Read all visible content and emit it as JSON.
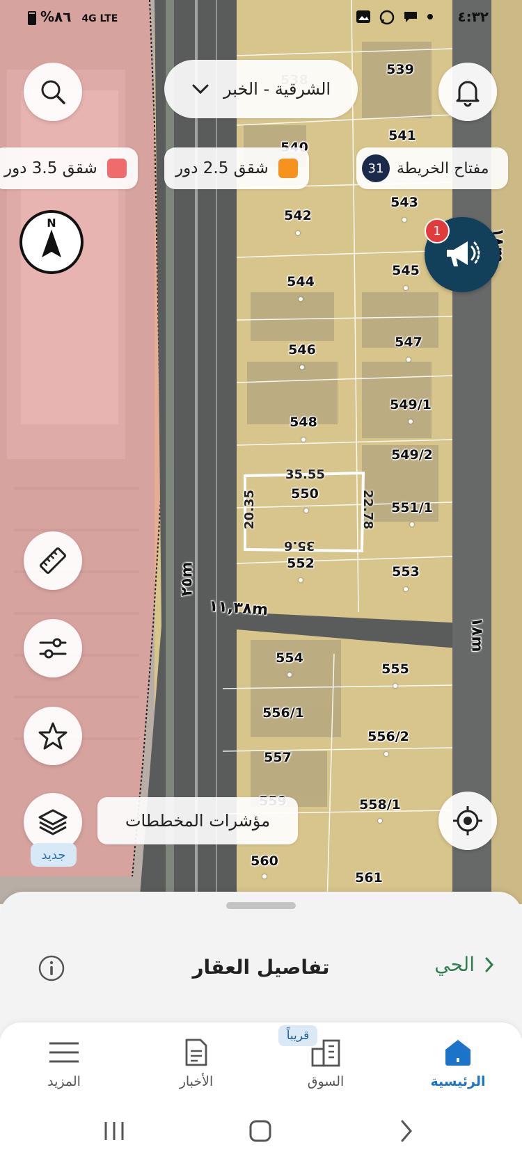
{
  "status_bar": {
    "time": "٤:٣٢",
    "battery": "%٨٦",
    "network": "4G LTE"
  },
  "map": {
    "region_selector": {
      "label": "الشرقية - الخبر"
    },
    "legend": [
      {
        "label": "شقق 3.5 دور",
        "color": "#f06b6b"
      },
      {
        "label": "شقق 2.5 دور",
        "color": "#f6931e"
      }
    ],
    "map_key": {
      "label": "مفتاح الخريطة",
      "count": "31"
    },
    "announcement": {
      "badge": "1"
    },
    "plots": [
      {
        "id": "538"
      },
      {
        "id": "539"
      },
      {
        "id": "540"
      },
      {
        "id": "541"
      },
      {
        "id": "542"
      },
      {
        "id": "543"
      },
      {
        "id": "544"
      },
      {
        "id": "545"
      },
      {
        "id": "546"
      },
      {
        "id": "547"
      },
      {
        "id": "548"
      },
      {
        "id": "549/1"
      },
      {
        "id": "549/2"
      },
      {
        "id": "550"
      },
      {
        "id": "551/1"
      },
      {
        "id": "552"
      },
      {
        "id": "553"
      },
      {
        "id": "554"
      },
      {
        "id": "555"
      },
      {
        "id": "556/1"
      },
      {
        "id": "556/2"
      },
      {
        "id": "557"
      },
      {
        "id": "558/1"
      },
      {
        "id": "559"
      },
      {
        "id": "560"
      },
      {
        "id": "561"
      }
    ],
    "selected_plot": {
      "id": "550",
      "top": "35.55",
      "bottom": "35.6",
      "left": "20.35",
      "right": "22.78"
    },
    "streets": [
      {
        "label": "٢٥m"
      },
      {
        "label": "١١,٣٨m"
      },
      {
        "label": "١٨m"
      },
      {
        "label": "١٨m"
      }
    ],
    "plans_indicators": {
      "label": "مؤشرات المخططات"
    },
    "new_badge": "جديد"
  },
  "bottom_sheet": {
    "title": "تفاصيل العقار",
    "district_link": "الحي"
  },
  "bottom_nav": {
    "items": [
      {
        "label": "المزيد"
      },
      {
        "label": "الأخبار"
      },
      {
        "label": "السوق"
      },
      {
        "label": "الرئيسية"
      }
    ],
    "soon_badge": "قريباً"
  },
  "colors": {
    "accent": "#1b74c9",
    "district_green": "#2f7d4f",
    "zone_red": "#f1a1a1",
    "land": "#d9c68e",
    "road": "#4d4f4f"
  }
}
